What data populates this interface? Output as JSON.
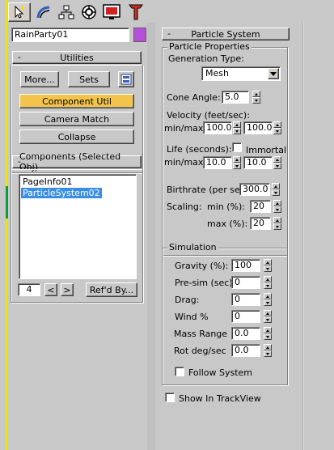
{
  "toolbar": {
    "tabs": [
      {
        "name": "create"
      },
      {
        "name": "modify"
      },
      {
        "name": "hierarchy"
      },
      {
        "name": "motion"
      },
      {
        "name": "display"
      },
      {
        "name": "utilities"
      }
    ]
  },
  "object": {
    "name": "RainParty01",
    "color": "#b64fd8"
  },
  "utilities": {
    "header": "Utilities",
    "more_label": "More...",
    "sets_label": "Sets",
    "component_util_label": "Component Util",
    "camera_match_label": "Camera Match",
    "collapse_label": "Collapse"
  },
  "components": {
    "header": "Components (Selected Obj)",
    "items": [
      "PageInfo01",
      "ParticleSystem02"
    ],
    "selected_index": 1,
    "count": "4",
    "prev_label": "<",
    "next_label": ">",
    "refd_by_label": "Ref'd By..."
  },
  "particle_system": {
    "header": "Particle System",
    "properties_group": "Particle Properties",
    "generation_type_label": "Generation Type:",
    "generation_type_value": "Mesh",
    "cone_angle_label": "Cone Angle:",
    "cone_angle_value": "5.0",
    "velocity_label": "Velocity (feet/sec):",
    "velocity_minmax_label": "min/max:",
    "velocity_min": "100.0",
    "velocity_max": "100.0",
    "life_label": "Life (seconds):",
    "immortal_label": "Immortal",
    "immortal_checked": false,
    "life_minmax_label": "min/max:",
    "life_min": "10.0",
    "life_max": "10.0",
    "birthrate_label": "Birthrate (per sec):",
    "birthrate_value": "300.0",
    "scaling_label": "Scaling:",
    "scaling_min_label": "min (%):",
    "scaling_min_value": "20",
    "scaling_max_label": "max (%):",
    "scaling_max_value": "20",
    "simulation_group": "Simulation",
    "gravity_label": "Gravity (%):",
    "gravity_value": "100",
    "presim_label": "Pre-sim (sec):",
    "presim_value": "0",
    "drag_label": "Drag:",
    "drag_value": "0",
    "wind_label": "Wind %",
    "wind_value": "0",
    "mass_range_label": "Mass Range",
    "mass_range_value": "0.0",
    "rot_label": "Rot deg/sec",
    "rot_value": "0.0",
    "follow_system_label": "Follow System",
    "follow_system_checked": false,
    "show_in_trackview_label": "Show In TrackView",
    "show_in_trackview_checked": false
  }
}
